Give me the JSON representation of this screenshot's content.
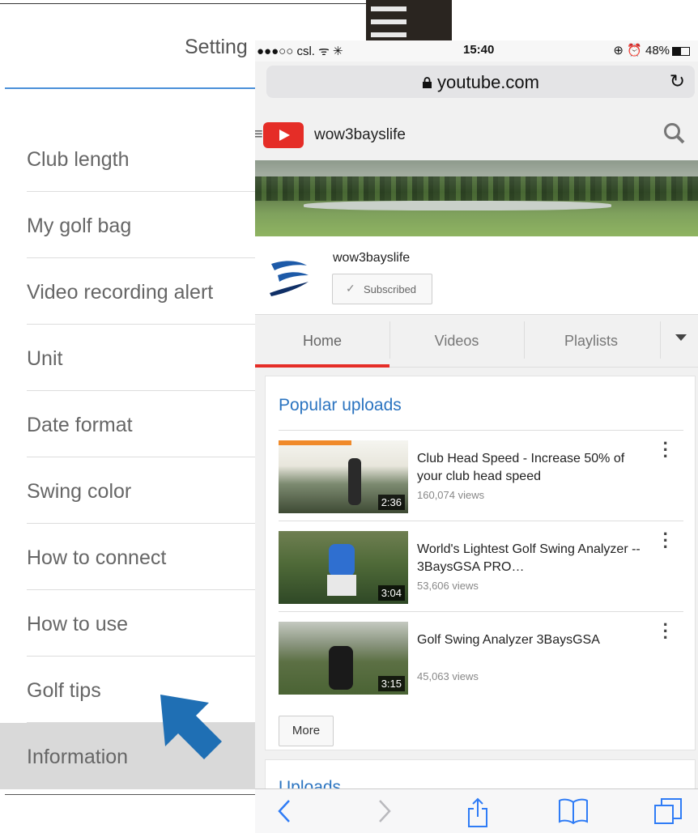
{
  "settings": {
    "title": "Setting",
    "items": [
      {
        "label": "Club length"
      },
      {
        "label": "My golf bag"
      },
      {
        "label": "Video recording alert"
      },
      {
        "label": "Unit"
      },
      {
        "label": "Date format"
      },
      {
        "label": "Swing color"
      },
      {
        "label": "How to connect"
      },
      {
        "label": "How to use"
      },
      {
        "label": "Golf tips"
      },
      {
        "label": "Information"
      }
    ],
    "active_item": "Information"
  },
  "status_bar": {
    "carrier": "●●●○○ csl. ᯤ ✳",
    "time": "15:40",
    "right": "⊕ ⏰ 48%"
  },
  "browser": {
    "url": "youtube.com",
    "lock_icon": "lock-icon",
    "reload_icon": "reload-icon"
  },
  "youtube": {
    "header_name": "wow3bayslife",
    "channel_name": "wow3bayslife",
    "subscribe_label": "Subscribed",
    "tabs": [
      {
        "label": "Home"
      },
      {
        "label": "Videos"
      },
      {
        "label": "Playlists"
      }
    ],
    "selected_tab": "Home",
    "popular_heading": "Popular uploads",
    "videos": [
      {
        "title": "Club Head Speed - Increase 50% of your club head speed",
        "views": "160,074 views",
        "duration": "2:36"
      },
      {
        "title": "World's Lightest Golf Swing Analyzer -- 3BaysGSA PRO…",
        "views": "53,606 views",
        "duration": "3:04"
      },
      {
        "title": "Golf Swing Analyzer 3BaysGSA",
        "views": "45,063 views",
        "duration": "3:15"
      }
    ],
    "more_label": "More",
    "uploads_heading": "Uploads"
  },
  "colors": {
    "accent_blue": "#2b74c0",
    "youtube_red": "#e52d27",
    "arrow_blue": "#1f6fb4"
  }
}
